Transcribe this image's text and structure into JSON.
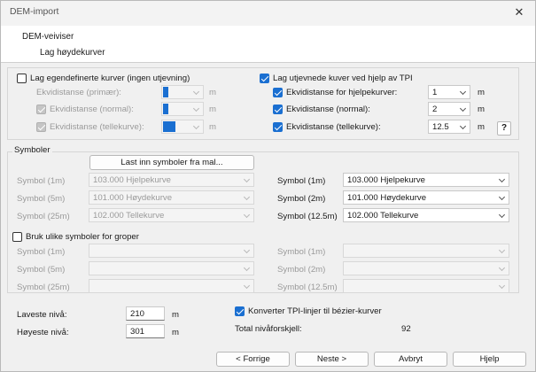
{
  "window": {
    "title": "DEM-import"
  },
  "header": {
    "line1": "DEM-veiviser",
    "line2": "Lag høydekurver"
  },
  "custom": {
    "checkbox_label": "Lag egendefinerte kurver (ingen utjevning)",
    "checked": false,
    "rows": [
      {
        "label": "Ekvidistanse (primær):",
        "checked": false,
        "unit": "m"
      },
      {
        "label": "Ekvidistanse (normal):",
        "checked": true,
        "unit": "m"
      },
      {
        "label": "Ekvidistanse (tellekurve):",
        "checked": true,
        "unit": "m"
      }
    ]
  },
  "smoothed": {
    "checkbox_label": "Lag utjevnede kuver ved hjelp av TPI",
    "checked": true,
    "rows": [
      {
        "label": "Ekvidistanse for hjelpekurver:",
        "value": "1",
        "unit": "m",
        "checked": true
      },
      {
        "label": "Ekvidistanse (normal):",
        "value": "2",
        "unit": "m",
        "checked": true
      },
      {
        "label": "Ekvidistanse (tellekurve):",
        "value": "12.5",
        "unit": "m",
        "checked": true
      }
    ],
    "help_label": "?"
  },
  "symbols": {
    "title": "Symboler",
    "load_button": "Last inn symboler fra mal...",
    "left": [
      {
        "label": "Symbol (1m)",
        "value": "103.000 Hjelpekurve"
      },
      {
        "label": "Symbol (5m)",
        "value": "101.000 Høydekurve"
      },
      {
        "label": "Symbol (25m)",
        "value": "102.000 Tellekurve"
      }
    ],
    "right": [
      {
        "label": "Symbol (1m)",
        "value": "103.000 Hjelpekurve"
      },
      {
        "label": "Symbol (2m)",
        "value": "101.000 Høydekurve"
      },
      {
        "label": "Symbol (12.5m)",
        "value": "102.000 Tellekurve"
      }
    ],
    "depressions_label": "Bruk ulike symboler for groper",
    "depressions_checked": false,
    "dep_left": [
      "Symbol (1m)",
      "Symbol (5m)",
      "Symbol (25m)"
    ],
    "dep_right": [
      "Symbol (1m)",
      "Symbol (2m)",
      "Symbol (12.5m)"
    ]
  },
  "levels": {
    "lowest_label": "Laveste nivå:",
    "lowest_value": "210",
    "highest_label": "Høyeste nivå:",
    "highest_value": "301",
    "unit": "m",
    "bezier_label": "Konverter TPI-linjer til bézier-kurver",
    "bezier_checked": true,
    "total_label": "Total nivåforskjell:",
    "total_value": "92"
  },
  "buttons": {
    "back": "< Forrige",
    "next": "Neste >",
    "cancel": "Avbryt",
    "help": "Hjelp"
  },
  "colors": {
    "accent": "#1a6fd1",
    "background": "#f0f0f0"
  }
}
